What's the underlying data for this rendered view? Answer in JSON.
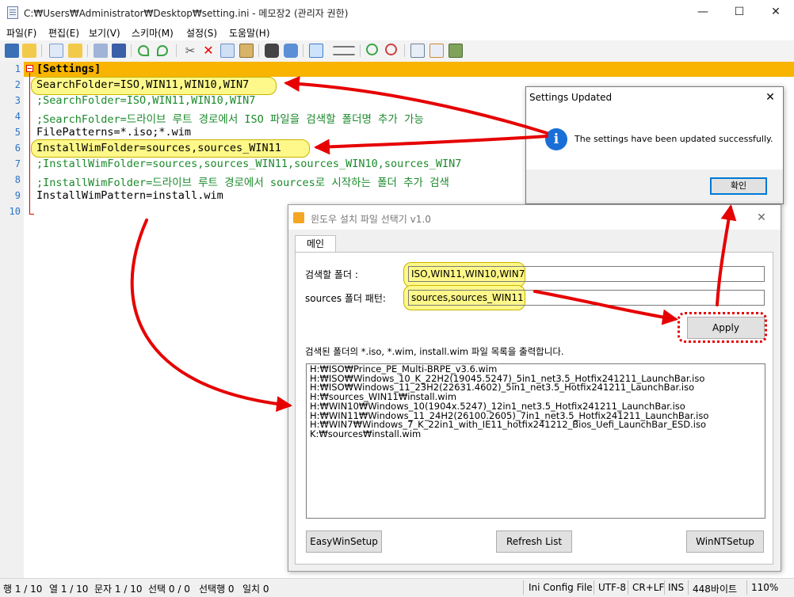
{
  "window": {
    "title": "C:₩Users₩Administrator₩Desktop₩setting.ini - 메모장2 (관리자 권한)",
    "minimize": "—",
    "maximize": "☐",
    "close": "✕"
  },
  "menu": [
    "파일(F)",
    "편집(E)",
    "보기(V)",
    "스키마(M)",
    "설정(S)",
    "도움말(H)"
  ],
  "editor": {
    "line_numbers": [
      "1",
      "2",
      "3",
      "4",
      "5",
      "6",
      "7",
      "8",
      "9",
      "10"
    ],
    "lines": [
      "[Settings]",
      "SearchFolder=ISO,WIN11,WIN10,WIN7",
      ";SearchFolder=ISO,WIN11,WIN10,WIN7",
      ";SearchFolder=드라이브 루트 경로에서 ISO 파일을 검색할 폴더명 추가 가능",
      "FilePatterns=*.iso;*.wim",
      "InstallWimFolder=sources,sources_WIN11",
      ";InstallWimFolder=sources,sources_WIN11,sources_WIN10,sources_WIN7",
      ";InstallWimFolder=드라이브 루트 경로에서 sources로 시작하는 폴더 추가 검색",
      "InstallWimPattern=install.wim",
      ""
    ]
  },
  "status": {
    "line": "행 1 / 10",
    "col": "열 1 / 10",
    "char": "문자 1 / 10",
    "sel": "선택 0 / 0",
    "selline": "선택행 0",
    "match": "일치 0",
    "scheme": "Ini Config File",
    "encoding": "UTF-8",
    "eol": "CR+LF",
    "ins": "INS",
    "size": "448바이트",
    "zoom": "110%"
  },
  "msgbox": {
    "title": "Settings Updated",
    "close": "✕",
    "icon": "info-icon",
    "message": "The settings have been updated successfully.",
    "ok": "확인"
  },
  "selector": {
    "title": "윈도우 설치 파일 선택기 v1.0",
    "close": "✕",
    "tab": "메인",
    "search_label": "검색할 폴더 :",
    "search_value": "ISO,WIN11,WIN10,WIN7",
    "sources_label": "sources 폴더 패턴:",
    "sources_value": "sources,sources_WIN11",
    "apply": "Apply",
    "list_caption": "검색된 폴더의 *.iso, *.wim, install.wim 파일 목록을 출력합니다.",
    "list": [
      "H:₩ISO₩Prince_PE_Multi-BRPE_v3.6.wim",
      "H:₩ISO₩Windows_10_K_22H2(19045.5247)_5in1_net3.5_Hotfix241211_LaunchBar.iso",
      "H:₩ISO₩Windows_11_23H2(22631.4602)_5in1_net3.5_Hotfix241211_LaunchBar.iso",
      "H:₩sources_WIN11₩install.wim",
      "H:₩WIN10₩Windows_10(1904x.5247)_12in1_net3.5_Hotfix241211_LaunchBar.iso",
      "H:₩WIN11₩Windows_11_24H2(26100.2605)_7in1_net3.5_Hotfix241211_LaunchBar.iso",
      "H:₩WIN7₩Windows_7_K_22in1_with_IE11_hotfix241212_Bios_Uefi_LaunchBar_ESD.iso",
      "K:₩sources₩install.wim"
    ],
    "buttons": [
      "EasyWinSetup",
      "Refresh List",
      "WinNTSetup"
    ]
  },
  "colors": {
    "highlight": "#fdf889",
    "arrow": "#e60000",
    "line_number": "#2b73c7",
    "comment": "#1b8a2b",
    "current_line": "#f8b400"
  }
}
